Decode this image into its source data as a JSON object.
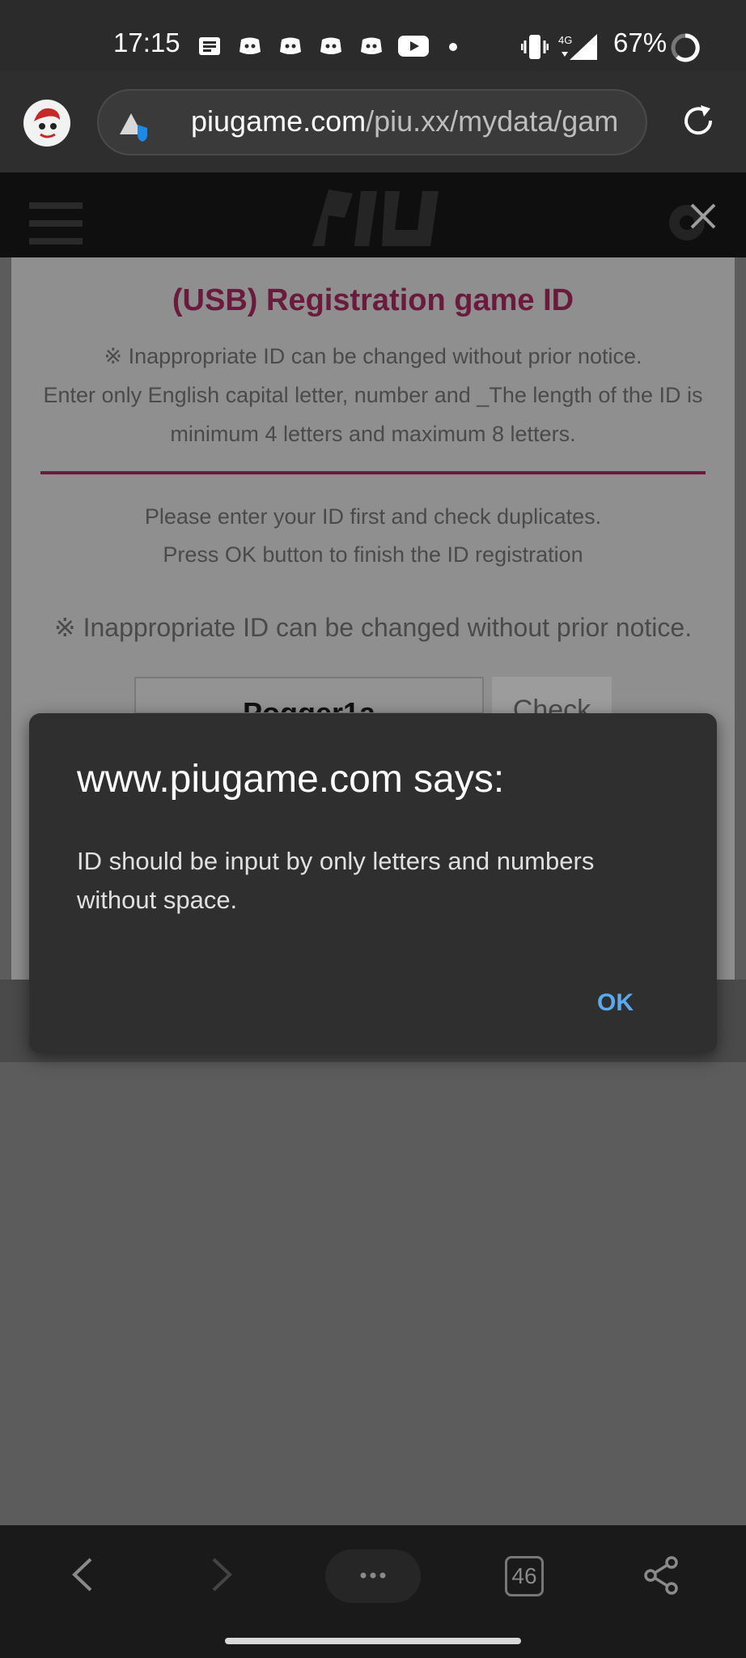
{
  "status_bar": {
    "time": "17:15",
    "network": "4G",
    "battery": "67%"
  },
  "browser": {
    "url_domain": "piugame.com",
    "url_path": "/piu.xx/mydata/gam",
    "tab_count": "46"
  },
  "page": {
    "title": "(USB) Registration game ID",
    "note_line1": "※ Inappropriate ID can be changed without prior notice.",
    "note_line2": "Enter only English capital letter, number and _The length of the ID is",
    "note_line3": "minimum 4 letters and maximum 8 letters.",
    "instruction_line1": "Please enter your ID first and check duplicates.",
    "instruction_line2": "Press OK button to finish the ID registration",
    "warning": "※ Inappropriate ID can be changed without prior notice.",
    "id_value": "Pogger1a",
    "check_label": "Check"
  },
  "alert": {
    "title": "www.piugame.com says:",
    "message": "ID should be input by only letters and numbers without space.",
    "ok_label": "OK"
  },
  "colors": {
    "accent": "#6a1a3c",
    "dialog_button": "#5aaaf0"
  }
}
